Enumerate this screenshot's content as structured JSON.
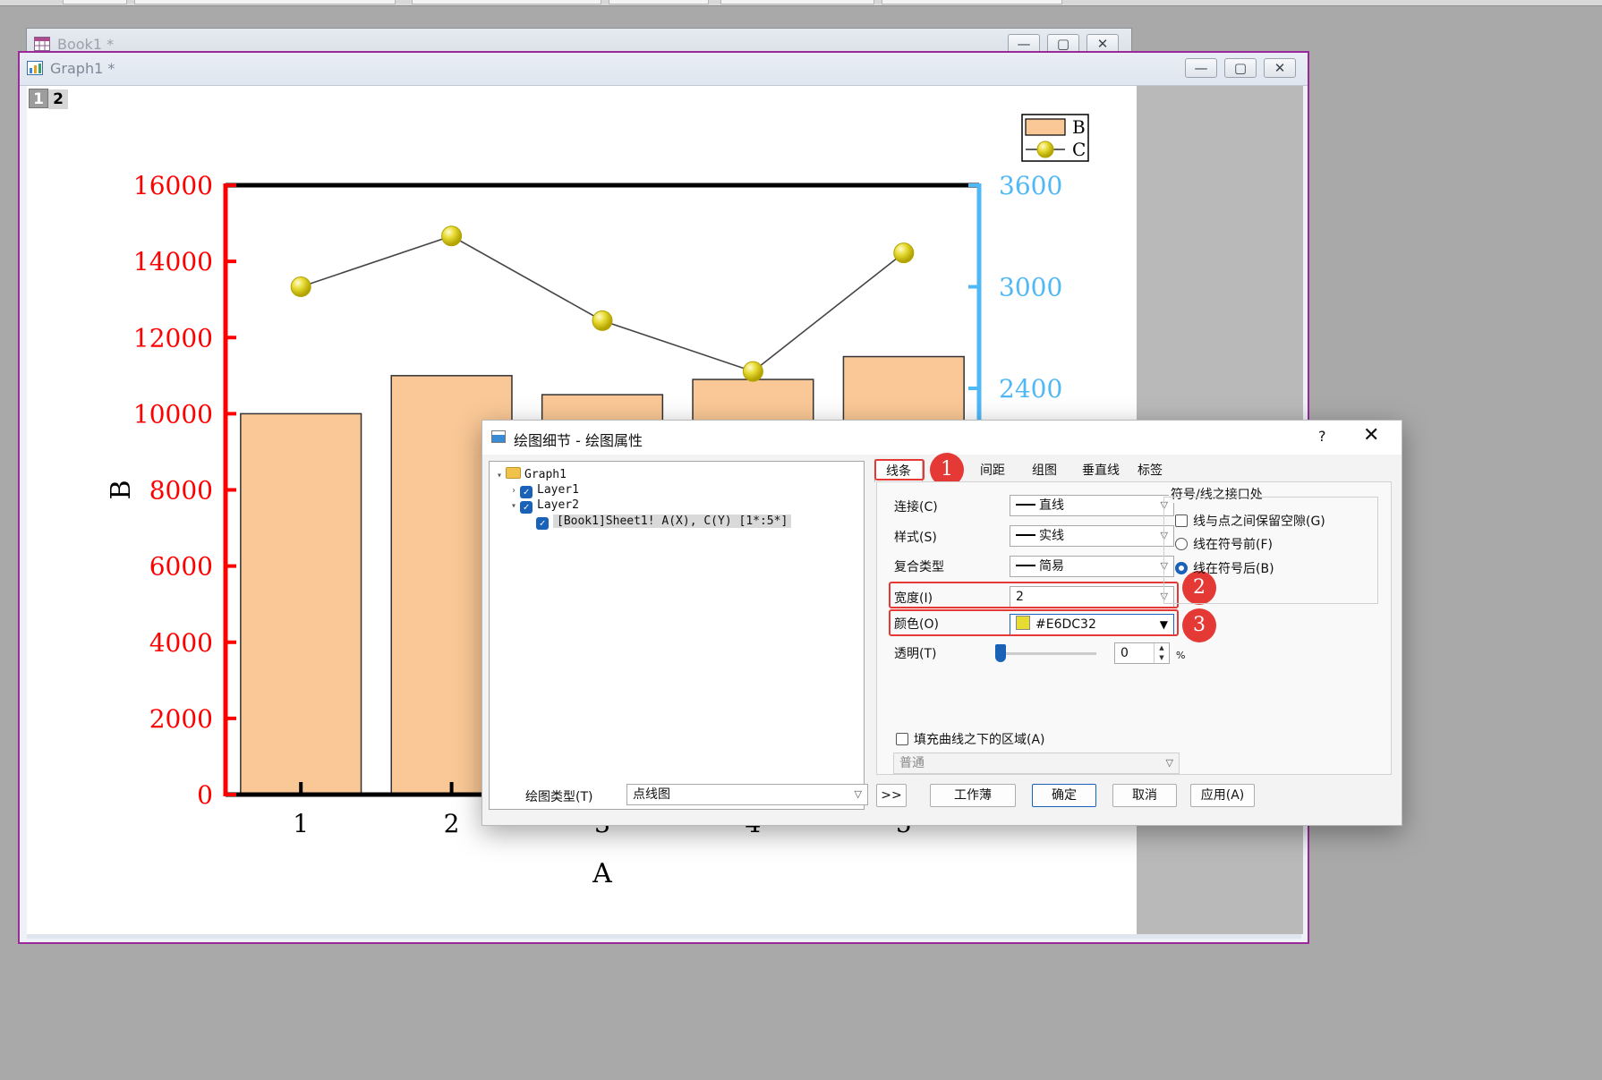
{
  "book1": {
    "title": "Book1 *"
  },
  "graph1": {
    "title": "Graph1 *",
    "layer_buttons": [
      "1",
      "2"
    ]
  },
  "window_buttons": {
    "minimize": "—",
    "restore": "▢",
    "close": "✕"
  },
  "chart_data": {
    "type": "bar",
    "xlabel": "A",
    "categories": [
      "1",
      "2",
      "3",
      "4",
      "5"
    ],
    "series": [
      {
        "name": "B",
        "type": "bar",
        "axis": "left",
        "values": [
          10000,
          11000,
          10500,
          10900,
          11500
        ],
        "color": "#FAC896"
      },
      {
        "name": "C",
        "type": "line",
        "axis": "right",
        "values": [
          3000,
          3300,
          2800,
          2500,
          3200
        ],
        "color": "#E6DC32"
      }
    ],
    "y_left": {
      "label": "B",
      "ticks": [
        "0",
        "2000",
        "4000",
        "6000",
        "8000",
        "10000",
        "12000",
        "14000",
        "16000"
      ],
      "range": [
        0,
        16000
      ],
      "color": "#FF0000"
    },
    "y_right": {
      "ticks_visible": [
        "2400",
        "3000",
        "3600"
      ],
      "range": [
        0,
        3600
      ],
      "color": "#4FB8F5"
    },
    "legend": {
      "placement": "top-right",
      "entries": [
        "B",
        "C"
      ]
    }
  },
  "dialog": {
    "title": "绘图细节 - 绘图属性",
    "help": "?",
    "close": "✕",
    "tree": {
      "root": "Graph1",
      "layer1": "Layer1",
      "layer2": "Layer2",
      "plot": "[Book1]Sheet1! A(X), C(Y) [1*:5*]"
    },
    "tabs": [
      "线条",
      "间距",
      "组图",
      "垂直线",
      "标签"
    ],
    "fields": {
      "connect_label": "连接(C)",
      "connect_value": "直线",
      "style_label": "样式(S)",
      "style_value": "实线",
      "compound_label": "复合类型",
      "compound_value": "简易",
      "width_label": "宽度(I)",
      "width_value": "2",
      "color_label": "颜色(O)",
      "color_value": "#E6DC32",
      "transparency_label": "透明(T)",
      "transparency_value": "0",
      "transparency_unit": "%"
    },
    "symbol_group": {
      "title": "符号/线之接口处",
      "options": [
        "线与点之间保留空隙(G)",
        "线在符号前(F)",
        "线在符号后(B)"
      ],
      "selected": "线在符号后(B)"
    },
    "fill_under": {
      "label": "填充曲线之下的区域(A)",
      "checked": false,
      "mode": "普通"
    },
    "plot_type_label": "绘图类型(T)",
    "plot_type_value": "点线图",
    "buttons": {
      "more": ">>",
      "workbook": "工作薄",
      "ok": "确定",
      "cancel": "取消",
      "apply": "应用(A)"
    },
    "badges": [
      "1",
      "2",
      "3"
    ],
    "highlight_color": "#E53935"
  }
}
